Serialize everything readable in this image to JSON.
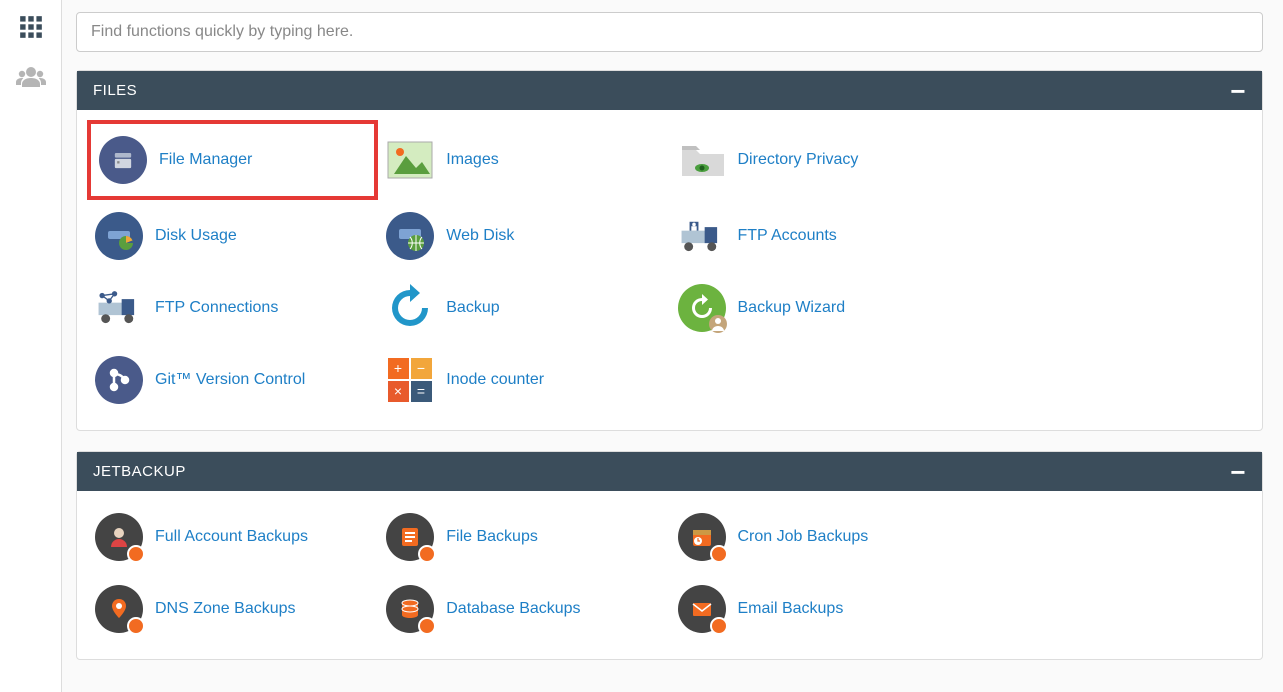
{
  "search": {
    "placeholder": "Find functions quickly by typing here."
  },
  "panels": [
    {
      "title": "FILES",
      "items": [
        {
          "label": "File Manager",
          "icon": "file-manager",
          "highlight": true
        },
        {
          "label": "Images",
          "icon": "images"
        },
        {
          "label": "Directory Privacy",
          "icon": "directory-privacy"
        },
        {
          "label": "",
          "icon": "blank"
        },
        {
          "label": "Disk Usage",
          "icon": "disk-usage"
        },
        {
          "label": "Web Disk",
          "icon": "web-disk"
        },
        {
          "label": "FTP Accounts",
          "icon": "ftp-accounts"
        },
        {
          "label": "",
          "icon": "blank"
        },
        {
          "label": "FTP Connections",
          "icon": "ftp-connections"
        },
        {
          "label": "Backup",
          "icon": "backup"
        },
        {
          "label": "Backup Wizard",
          "icon": "backup-wizard"
        },
        {
          "label": "",
          "icon": "blank"
        },
        {
          "label": "Git™ Version Control",
          "icon": "git"
        },
        {
          "label": "Inode counter",
          "icon": "inode"
        }
      ]
    },
    {
      "title": "JETBACKUP",
      "items": [
        {
          "label": "Full Account Backups",
          "icon": "jb-account"
        },
        {
          "label": "File Backups",
          "icon": "jb-file"
        },
        {
          "label": "Cron Job Backups",
          "icon": "jb-cron"
        },
        {
          "label": "",
          "icon": "blank"
        },
        {
          "label": "DNS Zone Backups",
          "icon": "jb-dns"
        },
        {
          "label": "Database Backups",
          "icon": "jb-db"
        },
        {
          "label": "Email Backups",
          "icon": "jb-email"
        }
      ]
    }
  ]
}
